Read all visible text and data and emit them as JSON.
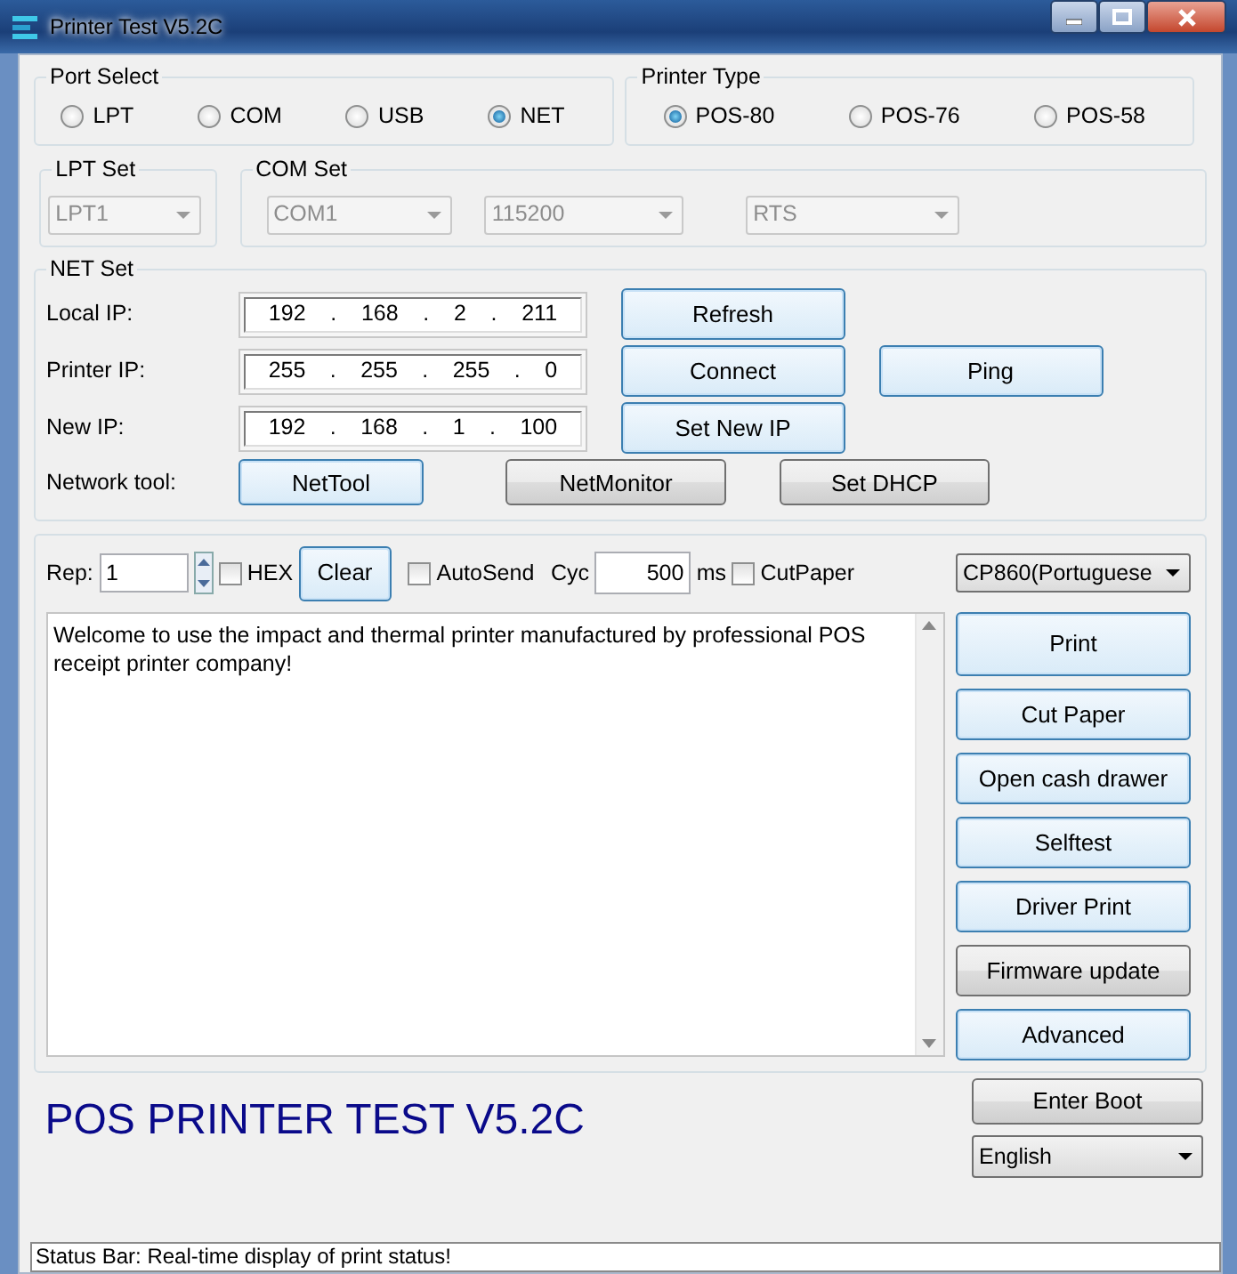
{
  "window": {
    "title": "Printer Test V5.2C"
  },
  "port_select": {
    "title": "Port Select",
    "options": [
      {
        "label": "LPT",
        "selected": false
      },
      {
        "label": "COM",
        "selected": false
      },
      {
        "label": "USB",
        "selected": false
      },
      {
        "label": "NET",
        "selected": true
      }
    ]
  },
  "printer_type": {
    "title": "Printer Type",
    "options": [
      {
        "label": "POS-80",
        "selected": true
      },
      {
        "label": "POS-76",
        "selected": false
      },
      {
        "label": "POS-58",
        "selected": false
      }
    ]
  },
  "lpt_set": {
    "title": "LPT Set",
    "dropdowns": [
      {
        "value": "LPT1",
        "disabled": true
      }
    ]
  },
  "com_set": {
    "title": "COM Set",
    "dropdowns": [
      {
        "value": "COM1",
        "disabled": true
      },
      {
        "value": "115200",
        "disabled": true
      },
      {
        "value": "RTS",
        "disabled": true
      }
    ]
  },
  "net_set": {
    "title": "NET Set",
    "rows": [
      {
        "label": "Local IP:",
        "ip": [
          "192",
          ".",
          "168",
          ".",
          "2",
          ".",
          "211"
        ],
        "buttons": [
          {
            "label": "Refresh",
            "highlighted": true
          }
        ]
      },
      {
        "label": "Printer IP:",
        "ip": [
          "255",
          ".",
          "255",
          ".",
          "255",
          ".",
          "0"
        ],
        "buttons": [
          {
            "label": "Connect",
            "highlighted": true
          },
          {
            "label": "Ping",
            "highlighted": true
          }
        ]
      },
      {
        "label": "New IP:",
        "ip": [
          "192",
          ".",
          "168",
          ".",
          "1",
          ".",
          "100"
        ],
        "buttons": [
          {
            "label": "Set New IP",
            "highlighted": true
          }
        ]
      }
    ],
    "tool_row": {
      "label": "Network tool:",
      "buttons": [
        {
          "label": "NetTool",
          "highlighted": true
        },
        {
          "label": "NetMonitor",
          "highlighted": false
        },
        {
          "label": "Set DHCP",
          "highlighted": false
        }
      ]
    }
  },
  "send_bar": {
    "rep_label": "Rep:",
    "rep_value": "1",
    "hex": {
      "label": "HEX",
      "checked": false
    },
    "clear": {
      "label": "Clear",
      "highlighted": true
    },
    "autosend": {
      "label": "AutoSend",
      "checked": false
    },
    "cyc_label": "Cyc",
    "cyc_value": "500",
    "ms_label": "ms",
    "cutpaper": {
      "label": "CutPaper",
      "checked": false
    },
    "codepage": "CP860(Portuguese"
  },
  "message": "Welcome to use the impact and thermal printer manufactured by professional POS receipt printer company!",
  "actions": [
    {
      "label": "Print",
      "highlighted": true
    },
    {
      "label": "Cut Paper",
      "highlighted": true
    },
    {
      "label": "Open cash drawer",
      "highlighted": true
    },
    {
      "label": "Selftest",
      "highlighted": true
    },
    {
      "label": "Driver Print",
      "highlighted": true
    },
    {
      "label": "Firmware update",
      "highlighted": false
    },
    {
      "label": "Advanced",
      "highlighted": true
    }
  ],
  "banner": "POS PRINTER TEST V5.2C",
  "boot_button": {
    "label": "Enter Boot",
    "highlighted": false
  },
  "language": "English",
  "status_bar": "Status Bar: Real-time display of print status!"
}
